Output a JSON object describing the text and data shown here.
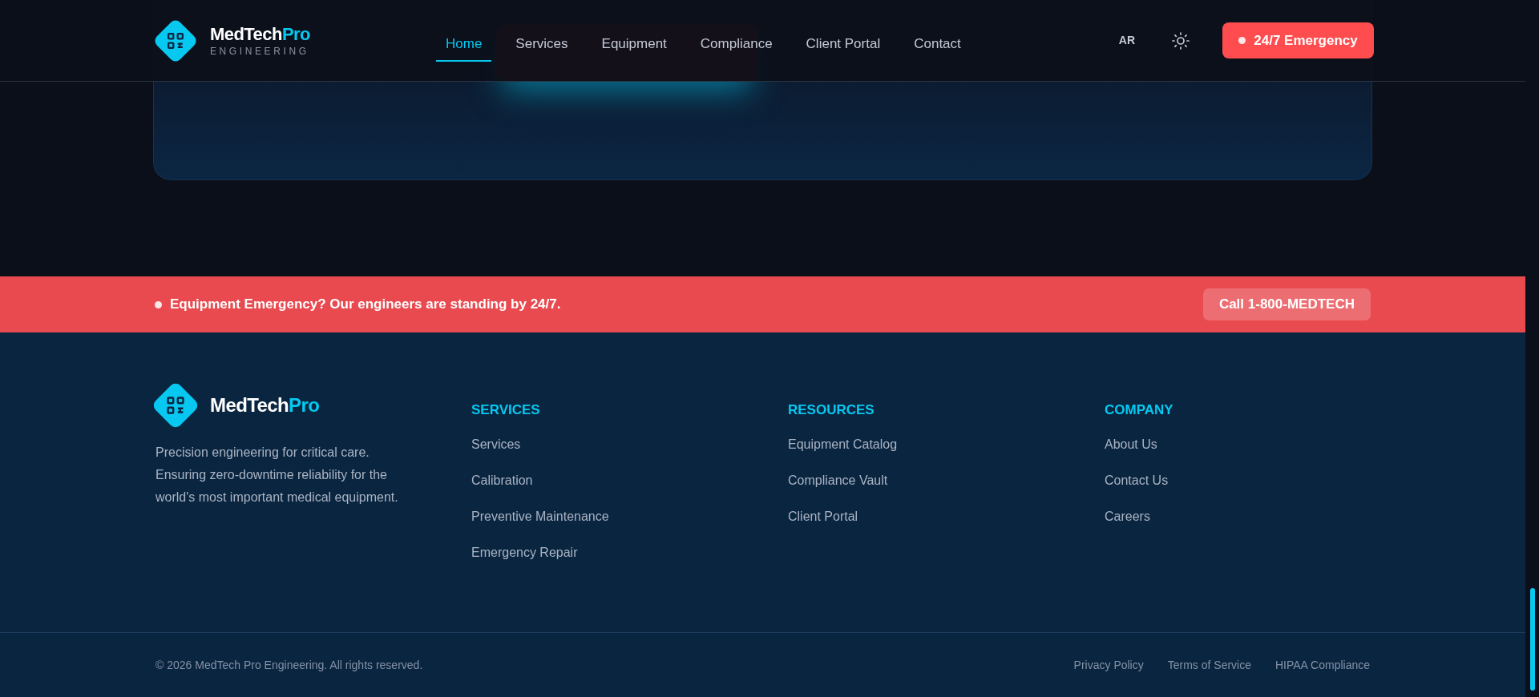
{
  "header": {
    "logo": {
      "name": "MedTech",
      "accent": "Pro",
      "tagline": "ENGINEERING"
    },
    "nav": [
      {
        "label": "Home",
        "selected": true
      },
      {
        "label": "Services",
        "selected": false
      },
      {
        "label": "Equipment",
        "selected": false
      },
      {
        "label": "Compliance",
        "selected": false
      },
      {
        "label": "Client Portal",
        "selected": false
      },
      {
        "label": "Contact",
        "selected": false
      }
    ],
    "language": "AR",
    "emergency_button": "24/7 Emergency"
  },
  "banner": {
    "message": "Equipment Emergency? Our engineers are standing by 24/7.",
    "button": "Call 1-800-MEDTECH"
  },
  "footer": {
    "brand": {
      "name": "MedTech",
      "accent": "Pro"
    },
    "description": "Precision engineering for critical care. Ensuring zero-downtime reliability for the world's most important medical equipment.",
    "columns": [
      {
        "heading": "SERVICES",
        "links": [
          "Services",
          "Calibration",
          "Preventive Maintenance",
          "Emergency Repair"
        ]
      },
      {
        "heading": "RESOURCES",
        "links": [
          "Equipment Catalog",
          "Compliance Vault",
          "Client Portal"
        ]
      },
      {
        "heading": "COMPANY",
        "links": [
          "About Us",
          "Contact Us",
          "Careers"
        ]
      }
    ],
    "copyright": "© 2026 MedTech Pro Engineering. All rights reserved.",
    "legal_links": [
      "Privacy Policy",
      "Terms of Service",
      "HIPAA Compliance"
    ]
  }
}
